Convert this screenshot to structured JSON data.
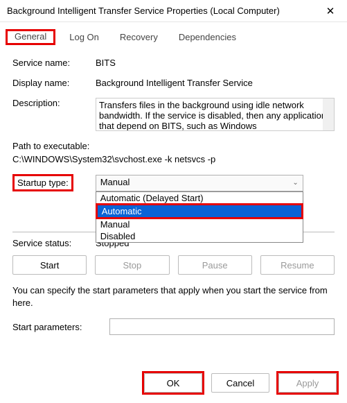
{
  "window": {
    "title": "Background Intelligent Transfer Service Properties (Local Computer)"
  },
  "tabs": {
    "general": "General",
    "logon": "Log On",
    "recovery": "Recovery",
    "dependencies": "Dependencies"
  },
  "fields": {
    "service_name_label": "Service name:",
    "service_name": "BITS",
    "display_name_label": "Display name:",
    "display_name": "Background Intelligent Transfer Service",
    "description_label": "Description:",
    "description": "Transfers files in the background using idle network bandwidth. If the service is disabled, then any applications that depend on BITS, such as Windows",
    "path_label": "Path to executable:",
    "path_value": "C:\\WINDOWS\\System32\\svchost.exe -k netsvcs -p",
    "startup_label": "Startup type:",
    "startup_value": "Manual"
  },
  "dropdown": {
    "opt_delayed": "Automatic (Delayed Start)",
    "opt_auto": "Automatic",
    "opt_manual": "Manual",
    "opt_disabled": "Disabled"
  },
  "status": {
    "label": "Service status:",
    "value": "Stopped"
  },
  "buttons": {
    "start": "Start",
    "stop": "Stop",
    "pause": "Pause",
    "resume": "Resume",
    "ok": "OK",
    "cancel": "Cancel",
    "apply": "Apply"
  },
  "hint": "You can specify the start parameters that apply when you start the service from here.",
  "params_label": "Start parameters:",
  "params_value": ""
}
